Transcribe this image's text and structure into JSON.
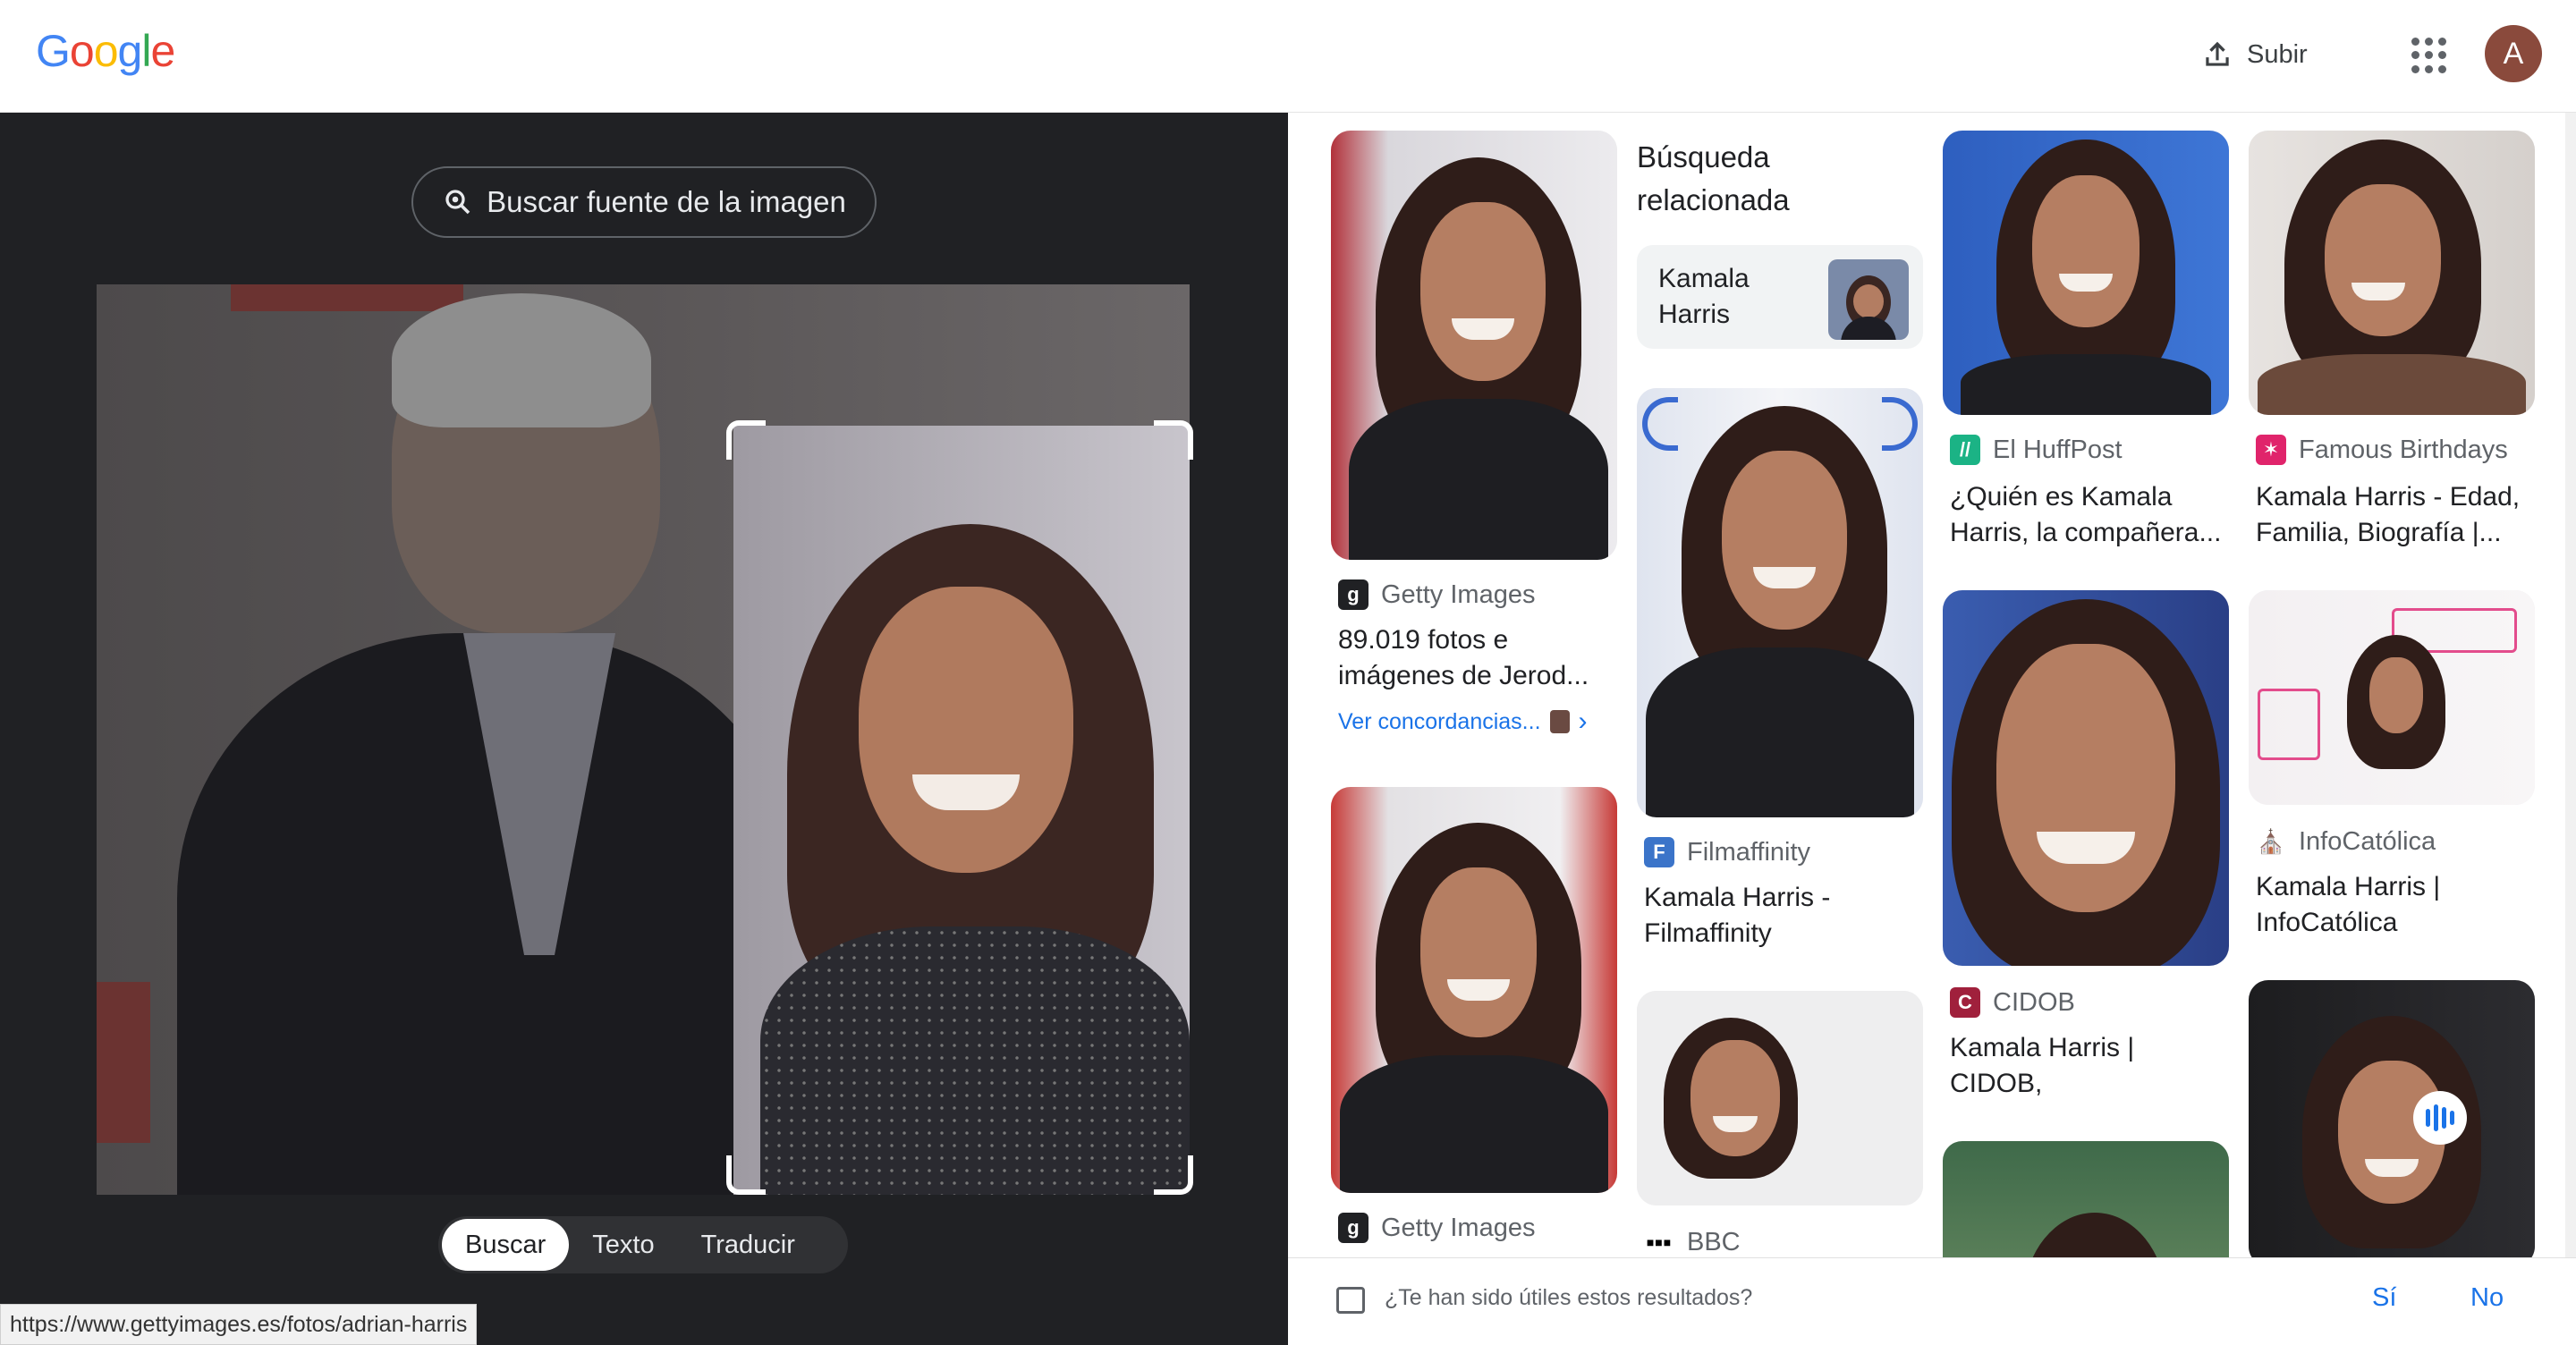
{
  "header": {
    "logo": [
      "G",
      "o",
      "o",
      "g",
      "l",
      "e"
    ],
    "logo_colors": [
      "#4285f4",
      "#ea4335",
      "#fbbc05",
      "#4285f4",
      "#34a853",
      "#ea4335"
    ],
    "upload_label": "Subir",
    "avatar_letter": "A"
  },
  "lens": {
    "source_button": "Buscar fuente de la imagen",
    "modes": [
      "Buscar",
      "Texto",
      "Traducir"
    ],
    "active_mode": "Buscar",
    "status_url": "https://www.gettyimages.es/fotos/adrian-harris"
  },
  "related": {
    "title_line1": "Búsqueda",
    "title_line2": "relacionada",
    "chip_line1": "Kamala",
    "chip_line2": "Harris"
  },
  "results": [
    {
      "source": "Getty Images",
      "title_line1": "89.019 fotos e",
      "title_line2": "imágenes de Jerod...",
      "more": "Ver concordancias..."
    },
    {
      "source": "Getty Images"
    },
    {
      "source": "Filmaffinity",
      "title_line1": "Kamala Harris -",
      "title_line2": "Filmaffinity"
    },
    {
      "source": "BBC"
    },
    {
      "source": "El HuffPost",
      "title_line1": "¿Quién es Kamala",
      "title_line2": "Harris, la compañera..."
    },
    {
      "source": "CIDOB",
      "title_line1": "Kamala Harris |",
      "title_line2": "CIDOB,"
    },
    {
      "source": "Famous Birthdays",
      "title_line1": "Kamala Harris - Edad,",
      "title_line2": "Familia, Biografía |..."
    },
    {
      "source": "InfoCatólica",
      "title_line1": "Kamala Harris |",
      "title_line2": "InfoCatólica"
    }
  ],
  "feedback": {
    "question": "¿Te han sido útiles estos resultados?",
    "yes": "Sí",
    "no": "No"
  },
  "colors": {
    "accent": "#1a73e8",
    "dark_panel": "#202124"
  }
}
